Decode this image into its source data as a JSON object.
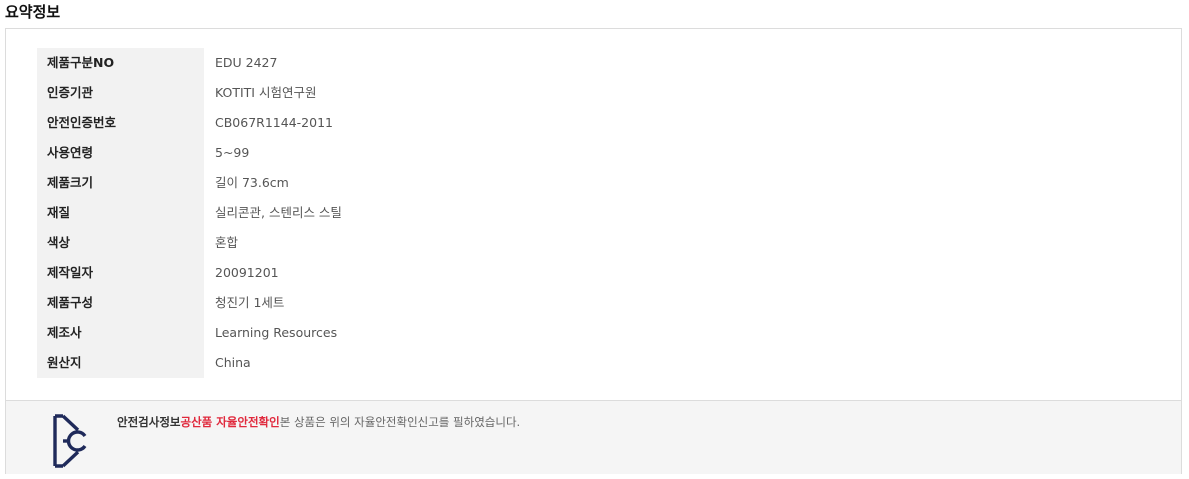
{
  "section": {
    "title": "요약정보"
  },
  "specs": [
    {
      "label": "제품구분NO",
      "value": "EDU 2427"
    },
    {
      "label": "인증기관",
      "value": "KOTITI 시험연구원"
    },
    {
      "label": "안전인증번호",
      "value": "CB067R1144-2011"
    },
    {
      "label": "사용연령",
      "value": "5~99"
    },
    {
      "label": "제품크기",
      "value": "길이 73.6cm"
    },
    {
      "label": "재질",
      "value": "실리콘관, 스텐리스 스틸"
    },
    {
      "label": "색상",
      "value": "혼합"
    },
    {
      "label": "제작일자",
      "value": "20091201"
    },
    {
      "label": "제품구성",
      "value": "청진기 1세트"
    },
    {
      "label": "제조사",
      "value": "Learning Resources"
    },
    {
      "label": "원산지",
      "value": "China"
    }
  ],
  "kc": {
    "logo_icon": "kc-certification-mark-icon",
    "label": "안전검사정보",
    "category": "공산품 자율안전확인",
    "description": "본 상품은 위의 자율안전확인신고를 필하였습니다.",
    "colors": {
      "category": "#e0283c",
      "logo": "#1f2a5a"
    }
  }
}
